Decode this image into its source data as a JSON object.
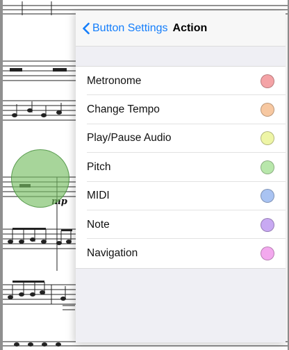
{
  "nav": {
    "back_label": "Button Settings",
    "title": "Action"
  },
  "actions": [
    {
      "label": "Metronome",
      "color": "#f4a3a6"
    },
    {
      "label": "Change Tempo",
      "color": "#f7c8a1"
    },
    {
      "label": "Play/Pause Audio",
      "color": "#eef5a6"
    },
    {
      "label": "Pitch",
      "color": "#b8e7ab"
    },
    {
      "label": "MIDI",
      "color": "#a9c3f2"
    },
    {
      "label": "Note",
      "color": "#c8a9f2"
    },
    {
      "label": "Navigation",
      "color": "#f3a9ee"
    }
  ],
  "score": {
    "dynamic_marking": "mp"
  },
  "colors": {
    "accent": "#147efb",
    "touch_circle": "#8bcb7a"
  }
}
